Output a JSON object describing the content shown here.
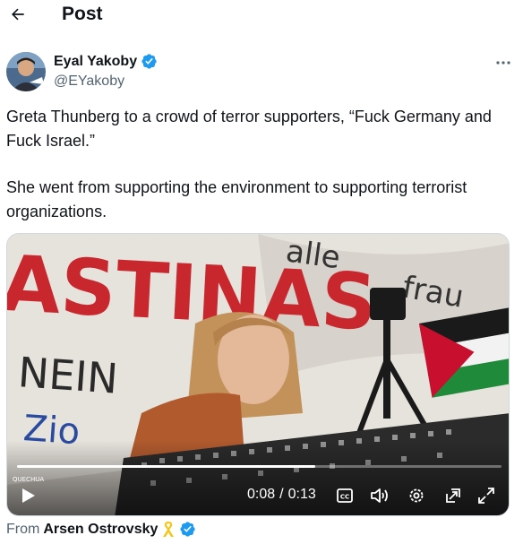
{
  "header": {
    "title": "Post",
    "back_icon": "arrow-left-icon"
  },
  "author": {
    "name": "Eyal Yakoby",
    "handle": "@EYakoby",
    "verified_color": "#1d9bf0"
  },
  "tweet": {
    "paragraphs": [
      "Greta Thunberg to a crowd of terror supporters, “Fuck Germany and Fuck Israel.”",
      "She went from supporting the environment to supporting terrorist organizations."
    ]
  },
  "media": {
    "banner_text_1": "ASTINAS",
    "banner_text_2": "NEIN",
    "banner_text_3": "Zio",
    "banner_text_4": "alle",
    "banner_text_5": "frau",
    "scarf_text": "QUECHUA",
    "current_time": "0:08",
    "separator": "/",
    "duration": "0:13",
    "progress": 0.615,
    "controls": [
      "play-icon",
      "captions-icon",
      "volume-icon",
      "settings-icon",
      "pip-icon",
      "fullscreen-icon"
    ]
  },
  "source": {
    "prefix": "From",
    "name": "Arsen Ostrovsky",
    "ribbon_icon": "yellow-ribbon-icon"
  }
}
